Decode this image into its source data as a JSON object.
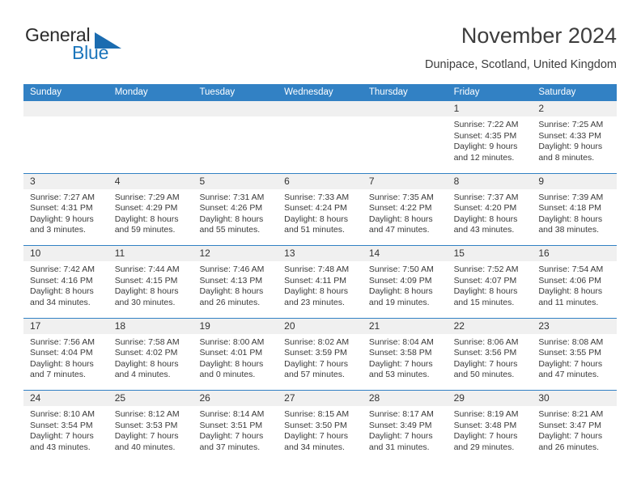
{
  "brand": {
    "name_top": "General",
    "name_bottom": "Blue",
    "accent_color": "#1b75bb",
    "triangle_icon": "triangle-icon"
  },
  "header": {
    "title": "November 2024",
    "location": "Dunipace, Scotland, United Kingdom"
  },
  "calendar": {
    "header_bg": "#3281c4",
    "day_band_bg": "#f0f0f0",
    "weekdays": [
      "Sunday",
      "Monday",
      "Tuesday",
      "Wednesday",
      "Thursday",
      "Friday",
      "Saturday"
    ],
    "weeks": [
      [
        {
          "day": "",
          "empty": true
        },
        {
          "day": "",
          "empty": true
        },
        {
          "day": "",
          "empty": true
        },
        {
          "day": "",
          "empty": true
        },
        {
          "day": "",
          "empty": true
        },
        {
          "day": "1",
          "sunrise": "Sunrise: 7:22 AM",
          "sunset": "Sunset: 4:35 PM",
          "daylight1": "Daylight: 9 hours",
          "daylight2": "and 12 minutes."
        },
        {
          "day": "2",
          "sunrise": "Sunrise: 7:25 AM",
          "sunset": "Sunset: 4:33 PM",
          "daylight1": "Daylight: 9 hours",
          "daylight2": "and 8 minutes."
        }
      ],
      [
        {
          "day": "3",
          "sunrise": "Sunrise: 7:27 AM",
          "sunset": "Sunset: 4:31 PM",
          "daylight1": "Daylight: 9 hours",
          "daylight2": "and 3 minutes."
        },
        {
          "day": "4",
          "sunrise": "Sunrise: 7:29 AM",
          "sunset": "Sunset: 4:29 PM",
          "daylight1": "Daylight: 8 hours",
          "daylight2": "and 59 minutes."
        },
        {
          "day": "5",
          "sunrise": "Sunrise: 7:31 AM",
          "sunset": "Sunset: 4:26 PM",
          "daylight1": "Daylight: 8 hours",
          "daylight2": "and 55 minutes."
        },
        {
          "day": "6",
          "sunrise": "Sunrise: 7:33 AM",
          "sunset": "Sunset: 4:24 PM",
          "daylight1": "Daylight: 8 hours",
          "daylight2": "and 51 minutes."
        },
        {
          "day": "7",
          "sunrise": "Sunrise: 7:35 AM",
          "sunset": "Sunset: 4:22 PM",
          "daylight1": "Daylight: 8 hours",
          "daylight2": "and 47 minutes."
        },
        {
          "day": "8",
          "sunrise": "Sunrise: 7:37 AM",
          "sunset": "Sunset: 4:20 PM",
          "daylight1": "Daylight: 8 hours",
          "daylight2": "and 43 minutes."
        },
        {
          "day": "9",
          "sunrise": "Sunrise: 7:39 AM",
          "sunset": "Sunset: 4:18 PM",
          "daylight1": "Daylight: 8 hours",
          "daylight2": "and 38 minutes."
        }
      ],
      [
        {
          "day": "10",
          "sunrise": "Sunrise: 7:42 AM",
          "sunset": "Sunset: 4:16 PM",
          "daylight1": "Daylight: 8 hours",
          "daylight2": "and 34 minutes."
        },
        {
          "day": "11",
          "sunrise": "Sunrise: 7:44 AM",
          "sunset": "Sunset: 4:15 PM",
          "daylight1": "Daylight: 8 hours",
          "daylight2": "and 30 minutes."
        },
        {
          "day": "12",
          "sunrise": "Sunrise: 7:46 AM",
          "sunset": "Sunset: 4:13 PM",
          "daylight1": "Daylight: 8 hours",
          "daylight2": "and 26 minutes."
        },
        {
          "day": "13",
          "sunrise": "Sunrise: 7:48 AM",
          "sunset": "Sunset: 4:11 PM",
          "daylight1": "Daylight: 8 hours",
          "daylight2": "and 23 minutes."
        },
        {
          "day": "14",
          "sunrise": "Sunrise: 7:50 AM",
          "sunset": "Sunset: 4:09 PM",
          "daylight1": "Daylight: 8 hours",
          "daylight2": "and 19 minutes."
        },
        {
          "day": "15",
          "sunrise": "Sunrise: 7:52 AM",
          "sunset": "Sunset: 4:07 PM",
          "daylight1": "Daylight: 8 hours",
          "daylight2": "and 15 minutes."
        },
        {
          "day": "16",
          "sunrise": "Sunrise: 7:54 AM",
          "sunset": "Sunset: 4:06 PM",
          "daylight1": "Daylight: 8 hours",
          "daylight2": "and 11 minutes."
        }
      ],
      [
        {
          "day": "17",
          "sunrise": "Sunrise: 7:56 AM",
          "sunset": "Sunset: 4:04 PM",
          "daylight1": "Daylight: 8 hours",
          "daylight2": "and 7 minutes."
        },
        {
          "day": "18",
          "sunrise": "Sunrise: 7:58 AM",
          "sunset": "Sunset: 4:02 PM",
          "daylight1": "Daylight: 8 hours",
          "daylight2": "and 4 minutes."
        },
        {
          "day": "19",
          "sunrise": "Sunrise: 8:00 AM",
          "sunset": "Sunset: 4:01 PM",
          "daylight1": "Daylight: 8 hours",
          "daylight2": "and 0 minutes."
        },
        {
          "day": "20",
          "sunrise": "Sunrise: 8:02 AM",
          "sunset": "Sunset: 3:59 PM",
          "daylight1": "Daylight: 7 hours",
          "daylight2": "and 57 minutes."
        },
        {
          "day": "21",
          "sunrise": "Sunrise: 8:04 AM",
          "sunset": "Sunset: 3:58 PM",
          "daylight1": "Daylight: 7 hours",
          "daylight2": "and 53 minutes."
        },
        {
          "day": "22",
          "sunrise": "Sunrise: 8:06 AM",
          "sunset": "Sunset: 3:56 PM",
          "daylight1": "Daylight: 7 hours",
          "daylight2": "and 50 minutes."
        },
        {
          "day": "23",
          "sunrise": "Sunrise: 8:08 AM",
          "sunset": "Sunset: 3:55 PM",
          "daylight1": "Daylight: 7 hours",
          "daylight2": "and 47 minutes."
        }
      ],
      [
        {
          "day": "24",
          "sunrise": "Sunrise: 8:10 AM",
          "sunset": "Sunset: 3:54 PM",
          "daylight1": "Daylight: 7 hours",
          "daylight2": "and 43 minutes."
        },
        {
          "day": "25",
          "sunrise": "Sunrise: 8:12 AM",
          "sunset": "Sunset: 3:53 PM",
          "daylight1": "Daylight: 7 hours",
          "daylight2": "and 40 minutes."
        },
        {
          "day": "26",
          "sunrise": "Sunrise: 8:14 AM",
          "sunset": "Sunset: 3:51 PM",
          "daylight1": "Daylight: 7 hours",
          "daylight2": "and 37 minutes."
        },
        {
          "day": "27",
          "sunrise": "Sunrise: 8:15 AM",
          "sunset": "Sunset: 3:50 PM",
          "daylight1": "Daylight: 7 hours",
          "daylight2": "and 34 minutes."
        },
        {
          "day": "28",
          "sunrise": "Sunrise: 8:17 AM",
          "sunset": "Sunset: 3:49 PM",
          "daylight1": "Daylight: 7 hours",
          "daylight2": "and 31 minutes."
        },
        {
          "day": "29",
          "sunrise": "Sunrise: 8:19 AM",
          "sunset": "Sunset: 3:48 PM",
          "daylight1": "Daylight: 7 hours",
          "daylight2": "and 29 minutes."
        },
        {
          "day": "30",
          "sunrise": "Sunrise: 8:21 AM",
          "sunset": "Sunset: 3:47 PM",
          "daylight1": "Daylight: 7 hours",
          "daylight2": "and 26 minutes."
        }
      ]
    ]
  }
}
